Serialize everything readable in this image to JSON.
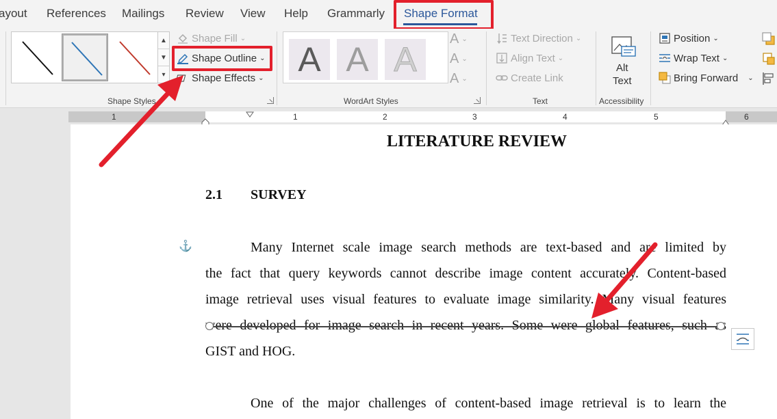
{
  "tabs": [
    {
      "label": "ayout"
    },
    {
      "label": "References"
    },
    {
      "label": "Mailings"
    },
    {
      "label": "Review"
    },
    {
      "label": "View"
    },
    {
      "label": "Help"
    },
    {
      "label": "Grammarly"
    },
    {
      "label": "Shape Format"
    }
  ],
  "ribbon": {
    "shape_fill": "Shape Fill",
    "shape_outline": "Shape Outline",
    "shape_effects": "Shape Effects",
    "shape_styles_label": "Shape Styles",
    "wordart_label": "WordArt Styles",
    "wordart_letter": "A",
    "text_direction": "Text Direction",
    "align_text": "Align Text",
    "create_link": "Create Link",
    "text_label": "Text",
    "alt_text_line1": "Alt",
    "alt_text_line2": "Text",
    "accessibility_label": "Accessibility",
    "position": "Position",
    "wrap_text": "Wrap Text",
    "bring_forward": "Bring Forward"
  },
  "ruler": {
    "numbers": [
      "1",
      "1",
      "2",
      "3",
      "4",
      "5",
      "6"
    ]
  },
  "document": {
    "heading": "LITERATURE REVIEW",
    "section_number": "2.1",
    "section_title": "SURVEY",
    "para1_lines": [
      "Many Internet scale image search methods are text-based and are limited by",
      "the fact that query keywords cannot describe image content accurately. Content-based",
      "image retrieval uses visual features to evaluate image similarity. Many visual features",
      "were developed for image search in recent years. Some were global features, such as",
      "GIST and HOG."
    ],
    "para2_line": "One of the major challenges of content-based image retrieval is to learn the"
  },
  "colors": {
    "accent": "#2b579a",
    "highlight": "#e3202c",
    "outline_blue": "#2e75b6"
  }
}
